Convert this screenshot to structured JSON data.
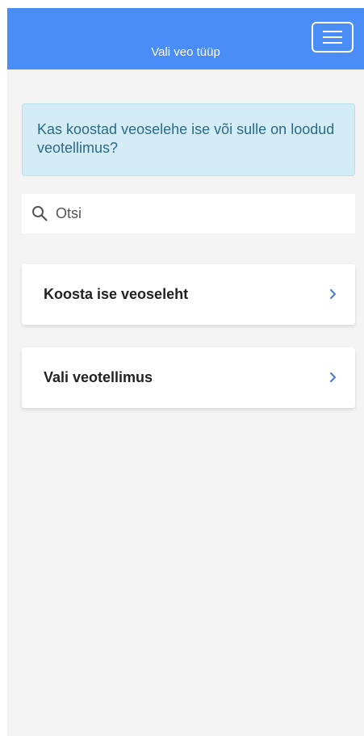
{
  "header": {
    "title": "Vali veo tüüp",
    "menu_icon": "hamburger-menu-icon"
  },
  "info": {
    "text": "Kas koostad veoselehe ise või sulle on loodud veotellimus?"
  },
  "search": {
    "icon": "search-icon",
    "placeholder": "Otsi"
  },
  "options": [
    {
      "label": "Koosta ise veoseleht",
      "icon": "chevron-right-icon"
    },
    {
      "label": "Vali veotellimus",
      "icon": "chevron-right-icon"
    }
  ],
  "colors": {
    "header_bg": "#4a8df6",
    "page_bg": "#f4f4f4",
    "info_bg": "#d4ecf5",
    "info_text": "#2d6a84",
    "chevron": "#4a7fd4"
  }
}
